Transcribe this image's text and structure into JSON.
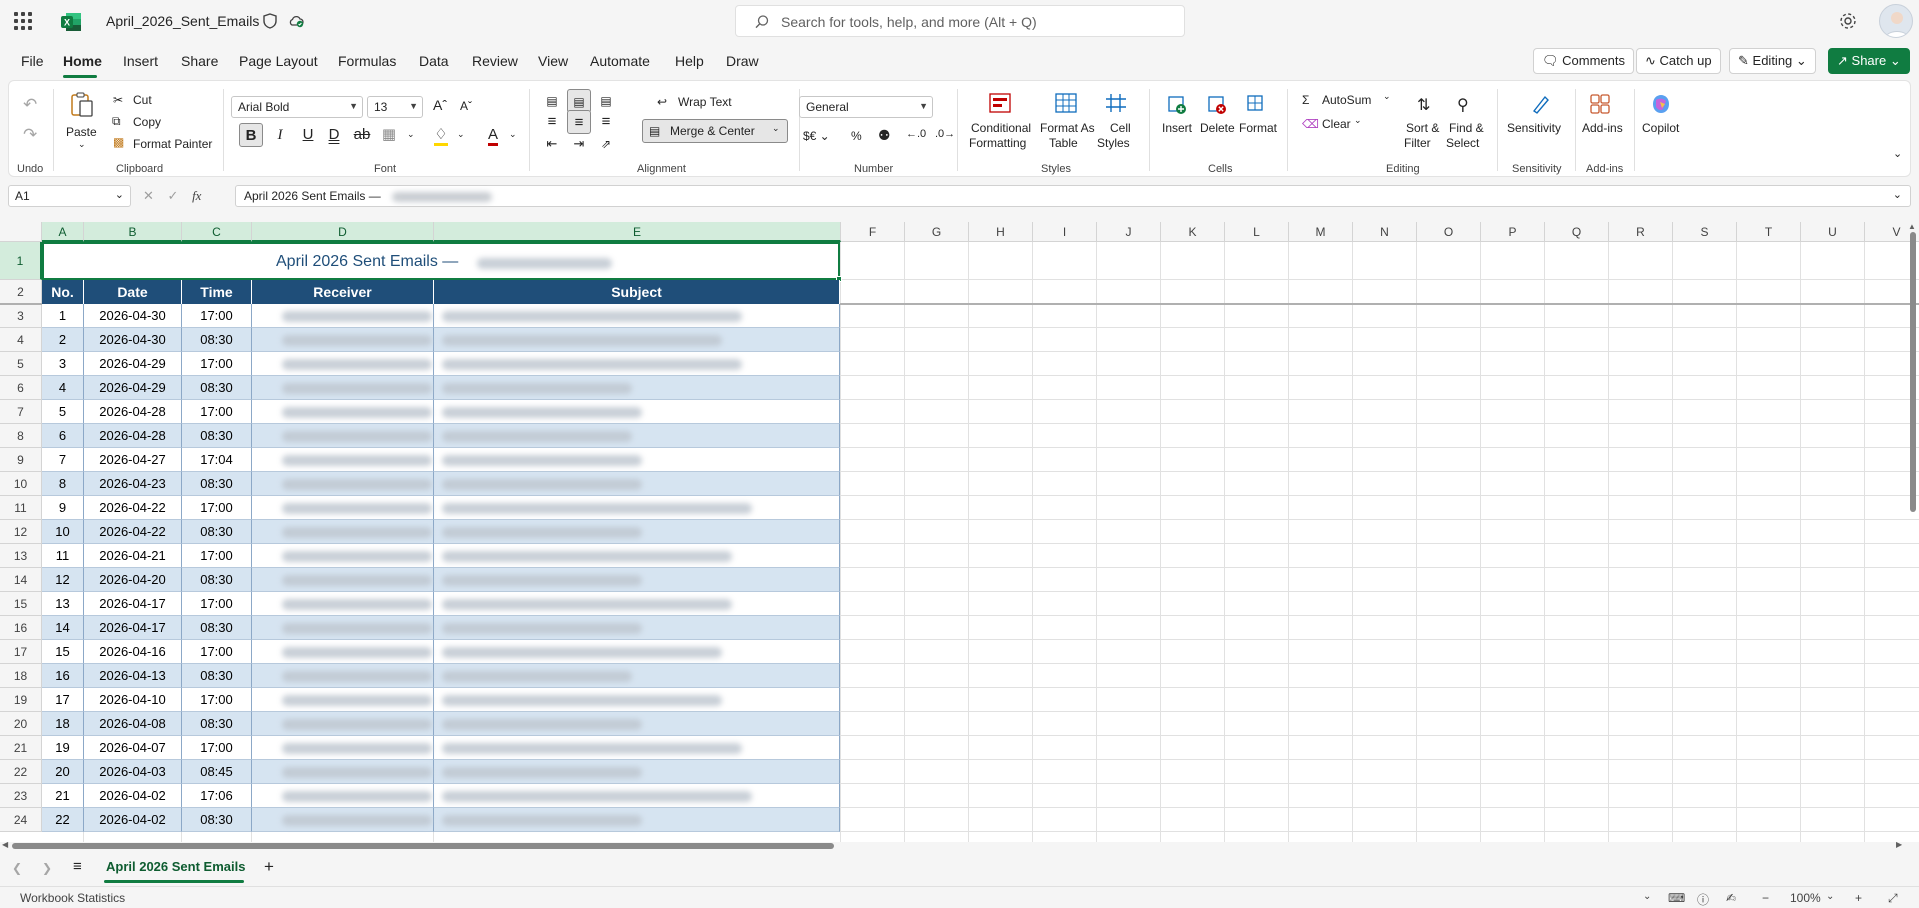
{
  "app": {
    "title": "April_2026_Sent_Emails",
    "search_placeholder": "Search for tools, help, and more (Alt + Q)"
  },
  "menu": {
    "tabs": [
      "File",
      "Home",
      "Insert",
      "Share",
      "Page Layout",
      "Formulas",
      "Data",
      "Review",
      "View",
      "Automate",
      "Help",
      "Draw"
    ],
    "active": "Home",
    "right": {
      "comments": "Comments",
      "catch_up": "Catch up",
      "editing": "Editing",
      "share": "Share"
    }
  },
  "ribbon": {
    "undo_group": "Undo",
    "clipboard": {
      "paste": "Paste",
      "cut": "Cut",
      "copy": "Copy",
      "format_painter": "Format Painter",
      "group": "Clipboard"
    },
    "font": {
      "family": "Arial Bold",
      "size": "13",
      "group": "Font"
    },
    "alignment": {
      "wrap_text": "Wrap Text",
      "merge_center": "Merge & Center",
      "group": "Alignment"
    },
    "number": {
      "format": "General",
      "group": "Number"
    },
    "styles": {
      "conditional_1": "Conditional",
      "conditional_2": "Formatting",
      "format_as_1": "Format As",
      "format_as_2": "Table",
      "cell_styles_1": "Cell",
      "cell_styles_2": "Styles",
      "group": "Styles"
    },
    "cells": {
      "insert": "Insert",
      "delete": "Delete",
      "format": "Format",
      "group": "Cells"
    },
    "editing": {
      "autosum": "AutoSum",
      "clear": "Clear",
      "sort_1": "Sort &",
      "sort_2": "Filter",
      "find_1": "Find &",
      "find_2": "Select",
      "group": "Editing"
    },
    "sensitivity": {
      "label": "Sensitivity",
      "group": "Sensitivity"
    },
    "addins": {
      "label": "Add-ins",
      "group": "Add-ins"
    },
    "copilot": "Copilot"
  },
  "formula_bar": {
    "name_box": "A1",
    "fx": "fx",
    "content": "April 2026 Sent Emails —"
  },
  "columns": [
    "A",
    "B",
    "C",
    "D",
    "E",
    "F",
    "G",
    "H",
    "I",
    "J",
    "K",
    "L",
    "M",
    "N",
    "O",
    "P",
    "Q",
    "R",
    "S",
    "T",
    "U",
    "V"
  ],
  "rows": [
    "1",
    "2",
    "3",
    "4",
    "5",
    "6",
    "7",
    "8",
    "9",
    "10",
    "11",
    "12",
    "13",
    "14",
    "15",
    "16",
    "17",
    "18",
    "19",
    "20",
    "21",
    "22",
    "23",
    "24"
  ],
  "sheet": {
    "title": "April 2026 Sent Emails —",
    "headers": {
      "no": "No.",
      "date": "Date",
      "time": "Time",
      "receiver": "Receiver",
      "subject": "Subject"
    },
    "rows": [
      {
        "no": "1",
        "date": "2026-04-30",
        "time": "17:00"
      },
      {
        "no": "2",
        "date": "2026-04-30",
        "time": "08:30"
      },
      {
        "no": "3",
        "date": "2026-04-29",
        "time": "17:00"
      },
      {
        "no": "4",
        "date": "2026-04-29",
        "time": "08:30"
      },
      {
        "no": "5",
        "date": "2026-04-28",
        "time": "17:00"
      },
      {
        "no": "6",
        "date": "2026-04-28",
        "time": "08:30"
      },
      {
        "no": "7",
        "date": "2026-04-27",
        "time": "17:04"
      },
      {
        "no": "8",
        "date": "2026-04-23",
        "time": "08:30"
      },
      {
        "no": "9",
        "date": "2026-04-22",
        "time": "17:00"
      },
      {
        "no": "10",
        "date": "2026-04-22",
        "time": "08:30"
      },
      {
        "no": "11",
        "date": "2026-04-21",
        "time": "17:00"
      },
      {
        "no": "12",
        "date": "2026-04-20",
        "time": "08:30"
      },
      {
        "no": "13",
        "date": "2026-04-17",
        "time": "17:00"
      },
      {
        "no": "14",
        "date": "2026-04-17",
        "time": "08:30"
      },
      {
        "no": "15",
        "date": "2026-04-16",
        "time": "17:00"
      },
      {
        "no": "16",
        "date": "2026-04-13",
        "time": "08:30"
      },
      {
        "no": "17",
        "date": "2026-04-10",
        "time": "17:00"
      },
      {
        "no": "18",
        "date": "2026-04-08",
        "time": "08:30"
      },
      {
        "no": "19",
        "date": "2026-04-07",
        "time": "17:00"
      },
      {
        "no": "20",
        "date": "2026-04-03",
        "time": "08:45"
      },
      {
        "no": "21",
        "date": "2026-04-02",
        "time": "17:06"
      },
      {
        "no": "22",
        "date": "2026-04-02",
        "time": "08:30"
      }
    ]
  },
  "sheet_tabs": {
    "active": "April 2026 Sent Emails"
  },
  "status": {
    "left": "Workbook Statistics",
    "zoom": "100%"
  },
  "colors": {
    "accent": "#107c41",
    "table_header": "#1f4e79",
    "band": "#d6e4f1"
  }
}
